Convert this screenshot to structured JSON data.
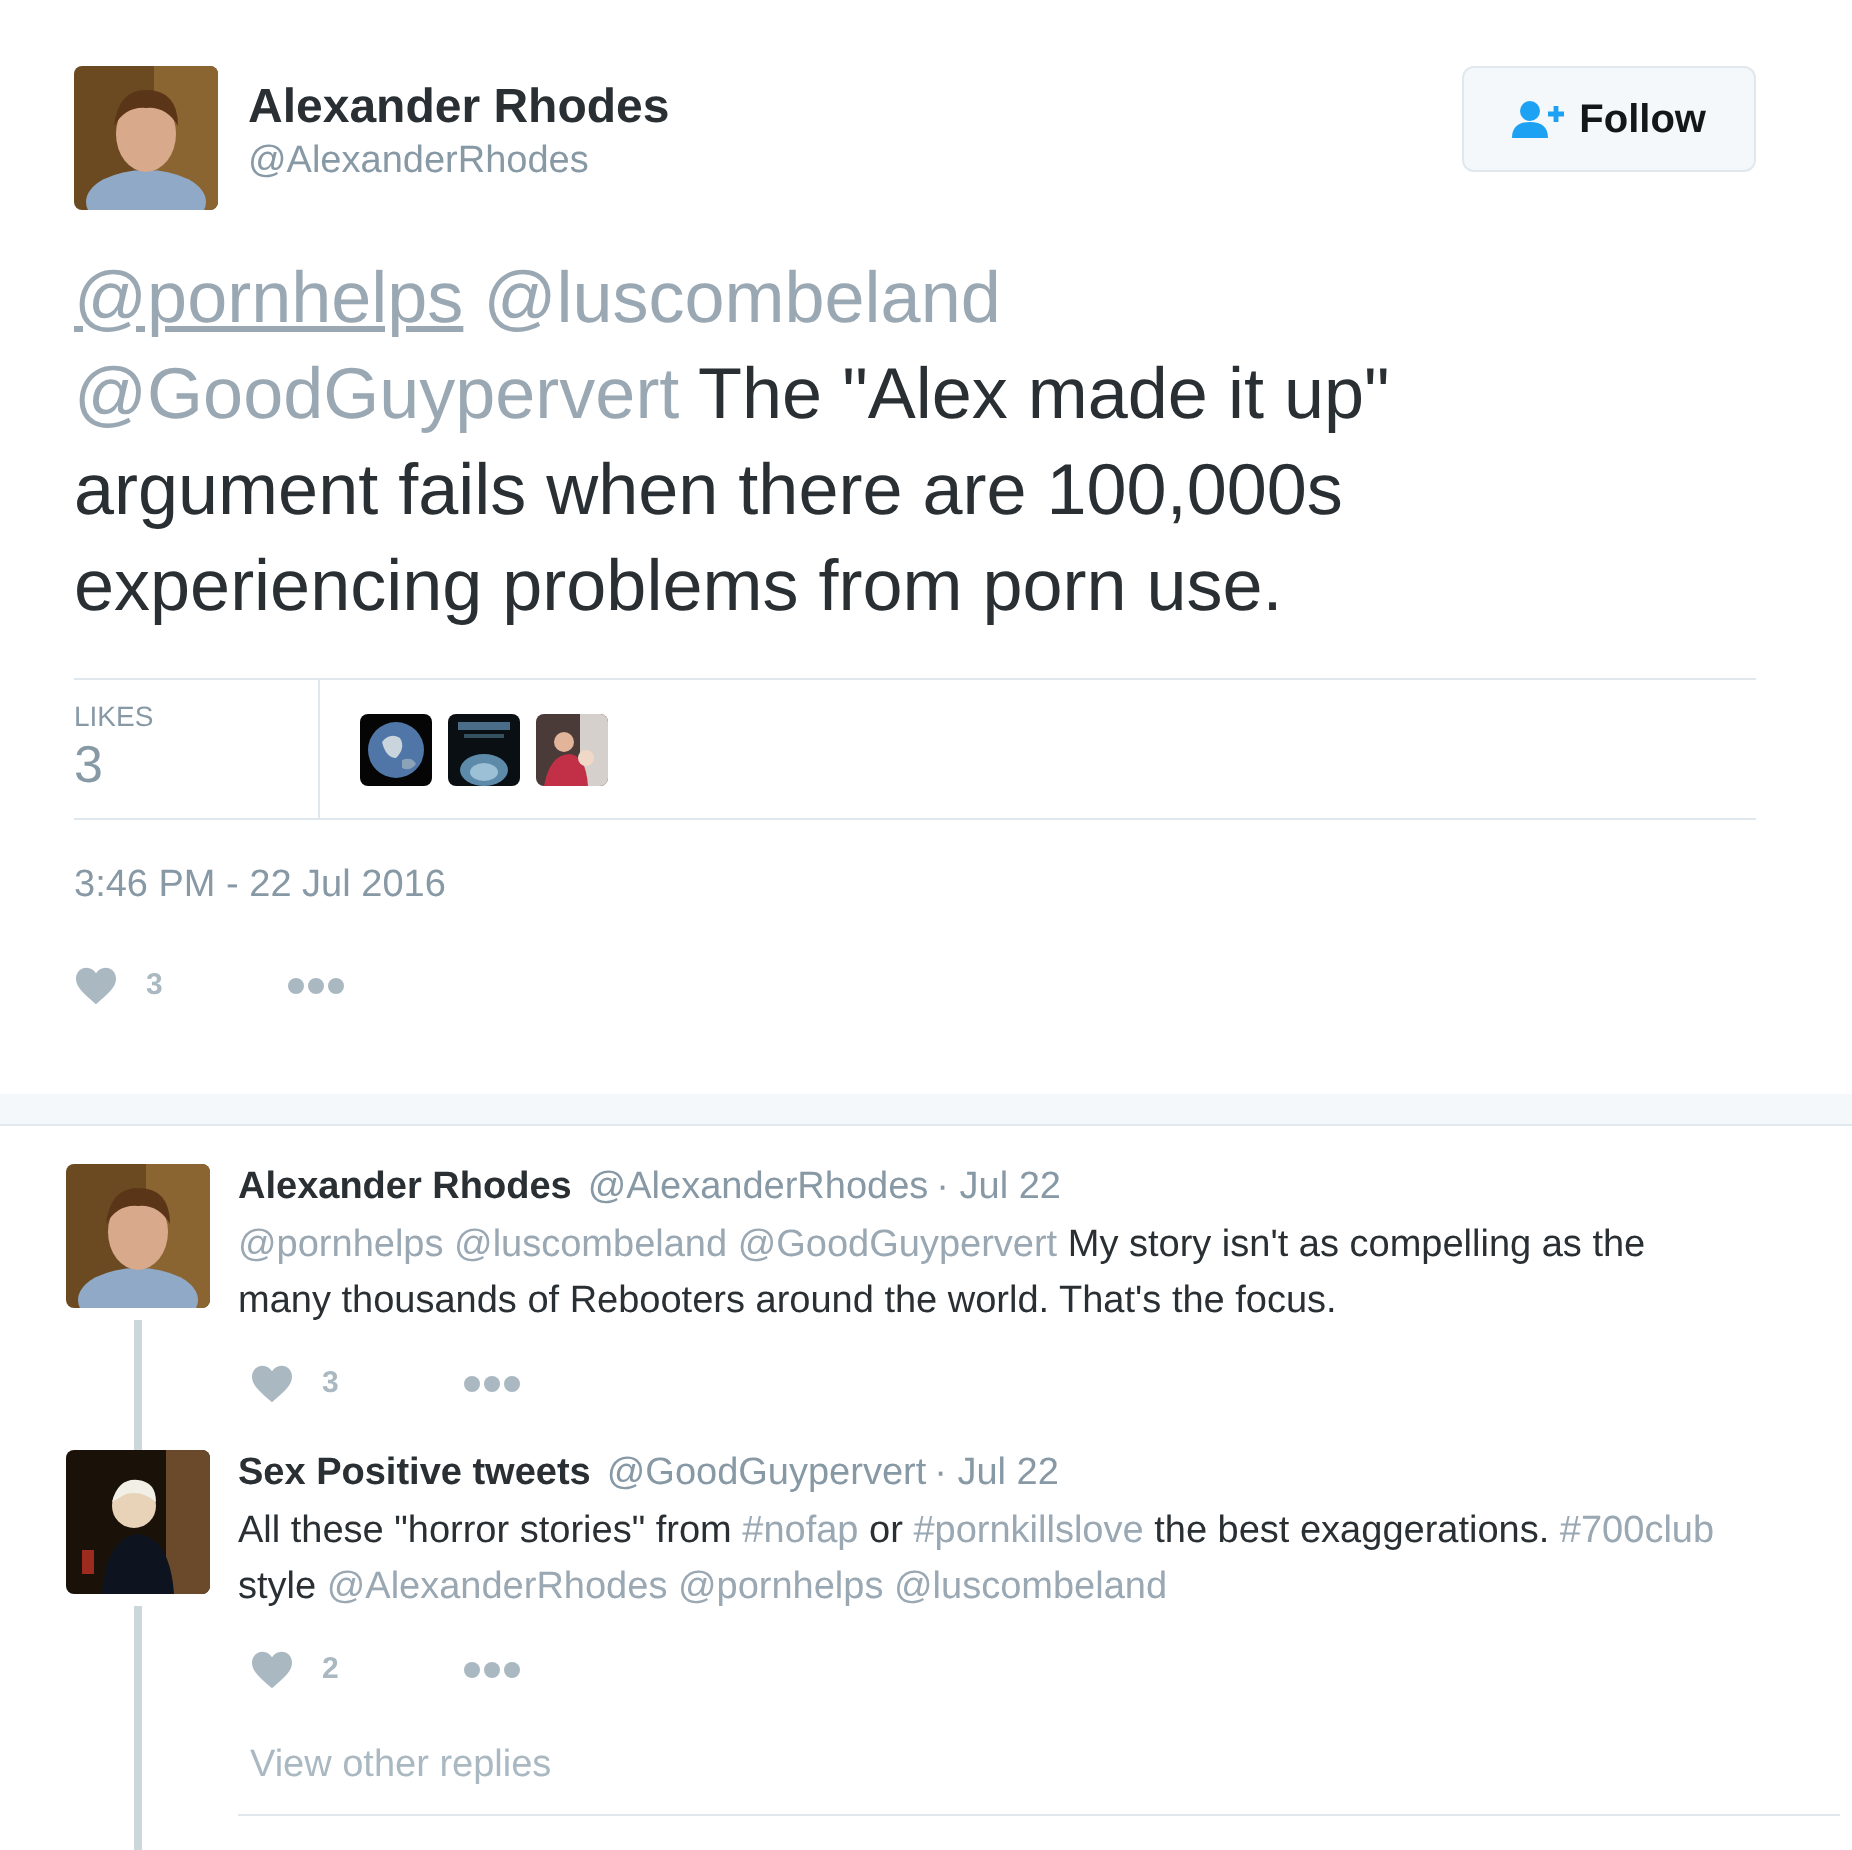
{
  "tweet": {
    "author": {
      "name": "Alexander Rhodes",
      "handle": "@AlexanderRhodes"
    },
    "follow_button": "Follow",
    "text": [
      {
        "kind": "link",
        "text": "@pornhelps",
        "underlined": true
      },
      {
        "kind": "link",
        "text": "@luscombeland",
        "underlined": false
      },
      {
        "kind": "link",
        "text": "@GoodGuypervert",
        "underlined": false
      },
      {
        "kind": "text",
        "text": " The \"Alex made it up\" argument fails when there are 100,000s experiencing problems from porn use."
      }
    ],
    "likes": {
      "label": "LIKES",
      "count": "3"
    },
    "timestamp": "3:46 PM - 22 Jul 2016",
    "like_count": "3"
  },
  "replies": [
    {
      "name": "Alexander Rhodes",
      "handle": "@AlexanderRhodes",
      "date": "· Jul 22",
      "like_count": "3",
      "text": [
        {
          "kind": "link",
          "text": "@pornhelps"
        },
        {
          "kind": "link",
          "text": "@luscombeland"
        },
        {
          "kind": "link",
          "text": "@GoodGuypervert"
        },
        {
          "kind": "text",
          "text": " My story isn't as compelling as the many thousands of Rebooters around the world. That's the focus."
        }
      ]
    },
    {
      "name": "Sex Positive tweets",
      "handle": "@GoodGuypervert",
      "date": "· Jul 22",
      "like_count": "2",
      "text": [
        {
          "kind": "text",
          "text": "All these \"horror stories\" from "
        },
        {
          "kind": "link",
          "text": "#nofap"
        },
        {
          "kind": "text",
          "text": " or "
        },
        {
          "kind": "link",
          "text": "#pornkillslove"
        },
        {
          "kind": "text",
          "text": " the best exaggerations. "
        },
        {
          "kind": "link",
          "text": "#700club"
        },
        {
          "kind": "text",
          "text": " style "
        },
        {
          "kind": "link",
          "text": "@AlexanderRhodes"
        },
        {
          "kind": "link",
          "text": "@pornhelps"
        },
        {
          "kind": "link",
          "text": "@luscombeland"
        }
      ]
    }
  ],
  "view_other_replies": "View other replies"
}
